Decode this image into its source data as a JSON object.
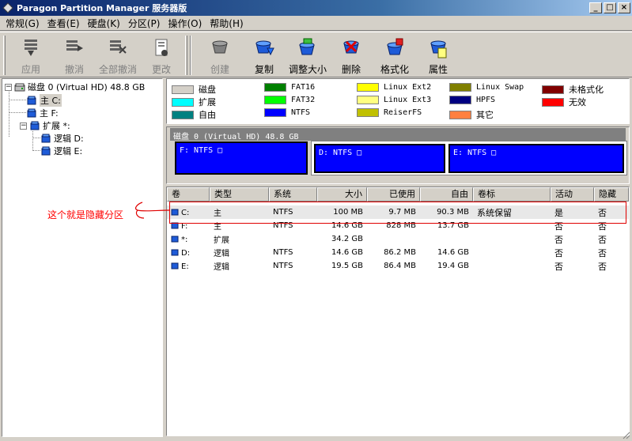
{
  "window": {
    "title": "Paragon Partition Manager 服务器版",
    "min": "_",
    "max": "□",
    "close": "×"
  },
  "menu": [
    "常规(G)",
    "查看(E)",
    "硬盘(K)",
    "分区(P)",
    "操作(O)",
    "帮助(H)"
  ],
  "toolbar": {
    "apply": "应用",
    "undo": "撤消",
    "undo_all": "全部撤消",
    "changes": "更改",
    "create": "创建",
    "copy": "复制",
    "resize": "调整大小",
    "delete": "删除",
    "format": "格式化",
    "properties": "属性"
  },
  "tree": {
    "disk": "磁盘 0 (Virtual HD) 48.8 GB",
    "primary_c": "主 C:",
    "primary_f": "主 F:",
    "extended": "扩展 *:",
    "logical_d": "逻辑 D:",
    "logical_e": "逻辑 E:"
  },
  "legend": [
    {
      "label": "磁盘",
      "color": "#d4d0c8"
    },
    {
      "label": "扩展",
      "color": "#00ffff"
    },
    {
      "label": "自由",
      "color": "#008080"
    },
    {
      "label": "FAT16",
      "color": "#008000"
    },
    {
      "label": "FAT32",
      "color": "#00ff00"
    },
    {
      "label": "NTFS",
      "color": "#0000ff"
    },
    {
      "label": "Linux Ext2",
      "color": "#ffff00"
    },
    {
      "label": "Linux Ext3",
      "color": "#ffff80"
    },
    {
      "label": "ReiserFS",
      "color": "#c0c000"
    },
    {
      "label": "Linux Swap",
      "color": "#808000"
    },
    {
      "label": "HPFS",
      "color": "#000080"
    },
    {
      "label": "其它",
      "color": "#ff8040"
    },
    {
      "label": "未格式化",
      "color": "#800000"
    },
    {
      "label": "无效",
      "color": "#ff0000"
    }
  ],
  "diskmap": {
    "label": "磁盘 0 (Virtual HD) 48.8 GB",
    "part_f": "F: NTFS □",
    "part_d": "D: NTFS □",
    "part_e": "E: NTFS □"
  },
  "grid": {
    "headers": [
      "卷",
      "类型",
      "系统",
      "大小",
      "已使用",
      "自由",
      "卷标",
      "活动",
      "隐藏"
    ],
    "rows": [
      [
        "C:",
        "主",
        "NTFS",
        "100 MB",
        "9.7 MB",
        "90.3 MB",
        "系统保留",
        "是",
        "否"
      ],
      [
        "F:",
        "主",
        "NTFS",
        "14.6 GB",
        "828 MB",
        "13.7 GB",
        "",
        "否",
        "否"
      ],
      [
        "*:",
        "扩展",
        "",
        "34.2 GB",
        "",
        "",
        "",
        "否",
        "否"
      ],
      [
        "D:",
        "逻辑",
        "NTFS",
        "14.6 GB",
        "86.2 MB",
        "14.6 GB",
        "",
        "否",
        "否"
      ],
      [
        "E:",
        "逻辑",
        "NTFS",
        "19.5 GB",
        "86.4 MB",
        "19.4 GB",
        "",
        "否",
        "否"
      ]
    ]
  },
  "annotation": "这个就是隐藏分区"
}
